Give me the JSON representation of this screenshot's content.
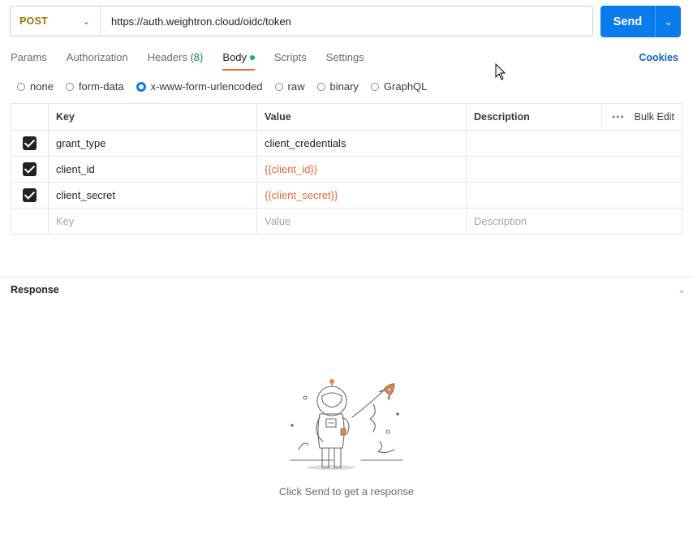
{
  "request": {
    "method": "POST",
    "url": "https://auth.weightron.cloud/oidc/token",
    "send_label": "Send"
  },
  "tabs": [
    {
      "label": "Params"
    },
    {
      "label": "Authorization"
    },
    {
      "label": "Headers",
      "count": "(8)"
    },
    {
      "label": "Body"
    },
    {
      "label": "Scripts"
    },
    {
      "label": "Settings"
    }
  ],
  "cookies_label": "Cookies",
  "body_types": [
    "none",
    "form-data",
    "x-www-form-urlencoded",
    "raw",
    "binary",
    "GraphQL"
  ],
  "body_type_selected": "x-www-form-urlencoded",
  "table": {
    "headers": {
      "key": "Key",
      "value": "Value",
      "description": "Description",
      "bulk_edit": "Bulk Edit"
    },
    "rows": [
      {
        "checked": true,
        "key": "grant_type",
        "value": "client_credentials",
        "description": ""
      },
      {
        "checked": true,
        "key": "client_id",
        "value": "{{client_id}}",
        "description": ""
      },
      {
        "checked": true,
        "key": "client_secret",
        "value": "{{client_secret}}",
        "description": ""
      }
    ],
    "placeholders": {
      "key": "Key",
      "value": "Value",
      "description": "Description"
    }
  },
  "response": {
    "title": "Response",
    "hint": "Click Send to get a response"
  },
  "colors": {
    "accent": "#097bed",
    "method": "#a2700b",
    "active_tab_underline": "#f26b3a",
    "variable": "#e8643c",
    "body_dot": "#0cbb52"
  }
}
